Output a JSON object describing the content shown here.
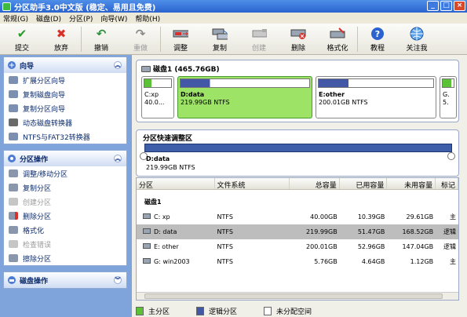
{
  "window": {
    "title": "分区助手3.0中文版 (稳定、易用且免费)"
  },
  "menu": [
    "常规(G)",
    "磁盘(D)",
    "分区(P)",
    "向导(W)",
    "帮助(H)"
  ],
  "toolbar": [
    {
      "label": "提交",
      "icon": "check-icon",
      "enabled": true
    },
    {
      "label": "放弃",
      "icon": "x-icon",
      "enabled": true
    },
    {
      "label": "撤销",
      "icon": "undo-icon",
      "enabled": true
    },
    {
      "label": "重做",
      "icon": "redo-icon",
      "enabled": false
    },
    {
      "label": "调整",
      "icon": "resize-icon",
      "enabled": true
    },
    {
      "label": "复制",
      "icon": "copy-disk-icon",
      "enabled": true
    },
    {
      "label": "创建",
      "icon": "create-disk-icon",
      "enabled": false
    },
    {
      "label": "删除",
      "icon": "delete-disk-icon",
      "enabled": true
    },
    {
      "label": "格式化",
      "icon": "format-icon",
      "enabled": true
    },
    {
      "label": "教程",
      "icon": "help-icon",
      "enabled": true
    },
    {
      "label": "关注我",
      "icon": "globe-icon",
      "enabled": true
    }
  ],
  "wizard_panel": {
    "title": "向导",
    "items": [
      "扩展分区向导",
      "复制磁盘向导",
      "复制分区向导",
      "动态磁盘转换器",
      "NTFS与FAT32转换器"
    ]
  },
  "partition_panel": {
    "title": "分区操作",
    "items": [
      {
        "label": "调整/移动分区",
        "enabled": true
      },
      {
        "label": "复制分区",
        "enabled": true
      },
      {
        "label": "创建分区",
        "enabled": false
      },
      {
        "label": "删除分区",
        "enabled": true
      },
      {
        "label": "格式化",
        "enabled": true
      },
      {
        "label": "检查错误",
        "enabled": false
      },
      {
        "label": "擦除分区",
        "enabled": true
      }
    ]
  },
  "disk_panel": {
    "title": "磁盘操作"
  },
  "disk": {
    "header": "磁盘1 (465.76GB)",
    "partitions": [
      {
        "line1": "C:xp",
        "line2": "40.0...",
        "selected": false,
        "fill_percent": 26
      },
      {
        "line1": "D:data",
        "line2": "219.99GB NTFS",
        "selected": true,
        "fill_percent": 23
      },
      {
        "line1": "E:other",
        "line2": "200.01GB NTFS",
        "selected": false,
        "fill_percent": 26
      },
      {
        "line1": "G.",
        "line2": "5.",
        "selected": false,
        "fill_percent": 80
      }
    ]
  },
  "quick": {
    "title": "分区快速调整区",
    "line1": "D:data",
    "line2": "219.99GB NTFS"
  },
  "table": {
    "headers": [
      "分区",
      "文件系统",
      "总容量",
      "已用容量",
      "未用容量",
      "标记"
    ],
    "group": "磁盘1",
    "rows": [
      {
        "name": "C: xp",
        "fs": "NTFS",
        "total": "40.00GB",
        "used": "10.39GB",
        "free": "29.61GB",
        "flag": "主",
        "selected": false
      },
      {
        "name": "D: data",
        "fs": "NTFS",
        "total": "219.99GB",
        "used": "51.47GB",
        "free": "168.52GB",
        "flag": "逻辑",
        "selected": true
      },
      {
        "name": "E: other",
        "fs": "NTFS",
        "total": "200.01GB",
        "used": "52.96GB",
        "free": "147.04GB",
        "flag": "逻辑",
        "selected": false
      },
      {
        "name": "G: win2003",
        "fs": "NTFS",
        "total": "5.76GB",
        "used": "4.64GB",
        "free": "1.12GB",
        "flag": "主",
        "selected": false
      }
    ]
  },
  "legend": [
    {
      "label": "主分区",
      "color": "#5bc238"
    },
    {
      "label": "逻辑分区",
      "color": "#4257a6"
    },
    {
      "label": "未分配空间",
      "color": "#ffffff"
    }
  ],
  "colors": {
    "selected_partition": "#9ce366",
    "used_bar": "#3e5ea9",
    "primary": "#5bc238"
  }
}
